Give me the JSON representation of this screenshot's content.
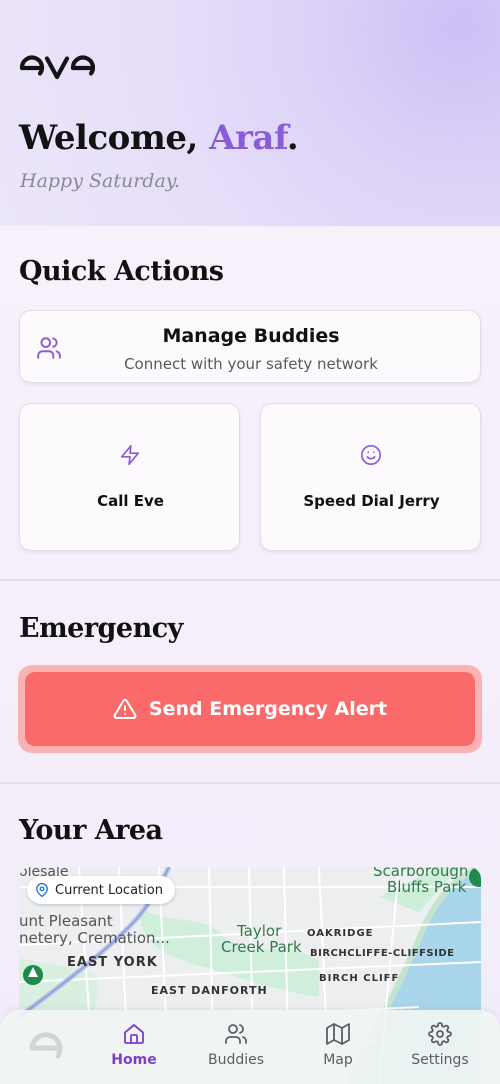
{
  "app": {
    "logo_text": "eve"
  },
  "header": {
    "welcome_prefix": "Welcome, ",
    "user_name": "Araf",
    "welcome_suffix": ".",
    "greeting": "Happy Saturday."
  },
  "quick_actions": {
    "title": "Quick Actions",
    "manage_buddies": {
      "title": "Manage Buddies",
      "subtitle": "Connect with your safety network",
      "icon": "users-icon"
    },
    "call_eve": {
      "label": "Call Eve",
      "icon": "zap-icon"
    },
    "speed_dial": {
      "label": "Speed Dial Jerry",
      "icon": "smile-icon"
    }
  },
  "emergency": {
    "title": "Emergency",
    "button_label": "Send Emergency Alert",
    "icon": "alert-triangle-icon"
  },
  "area": {
    "title": "Your Area",
    "current_location_label": "Current Location",
    "map_labels": {
      "top_left": "olesale",
      "mount_pleasant": "unt Pleasant",
      "cemetery": "netery, Cremation...",
      "east_york": "EAST YORK",
      "east_danforth": "EAST DANFORTH",
      "taylor_creek_1": "Taylor",
      "taylor_creek_2": "Creek Park",
      "oakridge": "OAKRIDGE",
      "birchcliffe": "BIRCHCLIFFE-CLIFFSIDE",
      "birch_cliff": "BIRCH CLIFF",
      "scarborough_1": "Scarborough",
      "scarborough_2": "Bluffs Park"
    }
  },
  "nav": {
    "items": [
      {
        "label": "Home",
        "icon": "home-icon",
        "active": true
      },
      {
        "label": "Buddies",
        "icon": "users-icon",
        "active": false
      },
      {
        "label": "Map",
        "icon": "map-icon",
        "active": false
      },
      {
        "label": "Settings",
        "icon": "settings-icon",
        "active": false
      }
    ]
  },
  "colors": {
    "accent": "#8b5cd6",
    "emergency": "#fa6a6a",
    "emergency_glow": "#fbb2b2",
    "nav_active": "#7c3ed0"
  }
}
